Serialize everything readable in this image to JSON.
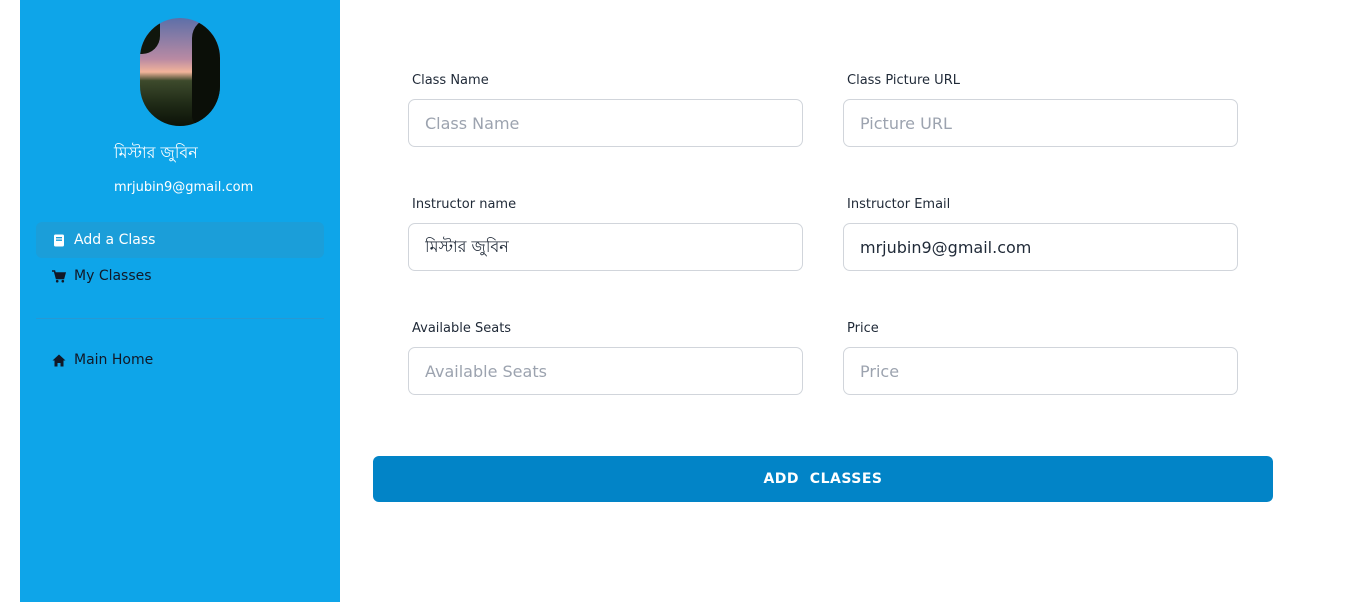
{
  "sidebar": {
    "user_name": "মিস্টার জুবিন",
    "user_email": "mrjubin9@gmail.com",
    "nav": [
      {
        "label": "Add a Class",
        "icon": "book-icon",
        "active": true
      },
      {
        "label": "My Classes",
        "icon": "cart-icon",
        "active": false
      }
    ],
    "home": {
      "label": "Main Home",
      "icon": "home-icon"
    }
  },
  "form": {
    "class_name": {
      "label": "Class Name",
      "placeholder": "Class Name",
      "value": ""
    },
    "picture_url": {
      "label": "Class Picture URL",
      "placeholder": "Picture URL",
      "value": ""
    },
    "instructor_name": {
      "label": "Instructor name",
      "value": "মিস্টার জুবিন"
    },
    "instructor_email": {
      "label": "Instructor Email",
      "value": "mrjubin9@gmail.com"
    },
    "seats": {
      "label": "Available Seats",
      "placeholder": "Available Seats",
      "value": ""
    },
    "price": {
      "label": "Price",
      "placeholder": "Price",
      "value": ""
    },
    "submit_label": "ADD  CLASSES"
  },
  "colors": {
    "sidebar_bg": "#0ea5e9",
    "active_item": "#1b9ed9",
    "button": "#0284c7"
  }
}
